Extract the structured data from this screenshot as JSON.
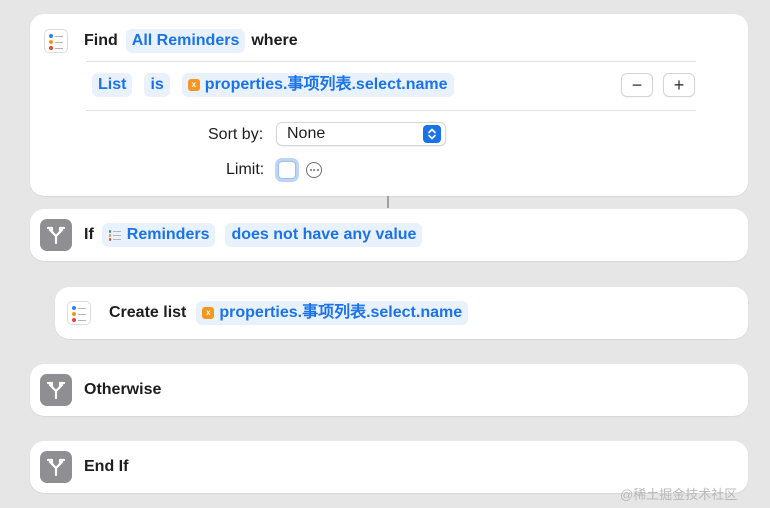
{
  "find_card": {
    "find_label": "Find",
    "entity_token": "All Reminders",
    "where_label": "where",
    "filter": {
      "field_token": "List",
      "operator_token": "is",
      "value_token": "properties.事项列表.select.name",
      "remove_button": "−",
      "add_button": "+"
    },
    "sort_by_label": "Sort by:",
    "sort_by_value": "None",
    "limit_label": "Limit:",
    "limit_checked": false
  },
  "if_card": {
    "if_label": "If",
    "input_token": "Reminders",
    "condition_token": "does not have any value"
  },
  "create_list_card": {
    "label": "Create list",
    "value_token": "properties.事项列表.select.name"
  },
  "otherwise_card": {
    "label": "Otherwise"
  },
  "endif_card": {
    "label": "End If"
  },
  "variable_icon_glyph": "x",
  "colors": {
    "accent": "#1a73e8",
    "token_bg": "#e9f1fc",
    "branch_icon_bg": "#8e8e93",
    "variable_icon": "#f5961f",
    "background": "#e6e6e6"
  },
  "icons": [
    "reminders-list-icon",
    "branch-icon",
    "variable-icon",
    "minus-icon",
    "plus-icon",
    "chevron-updown-icon",
    "more-icon"
  ],
  "watermark": "@稀土掘金技术社区"
}
